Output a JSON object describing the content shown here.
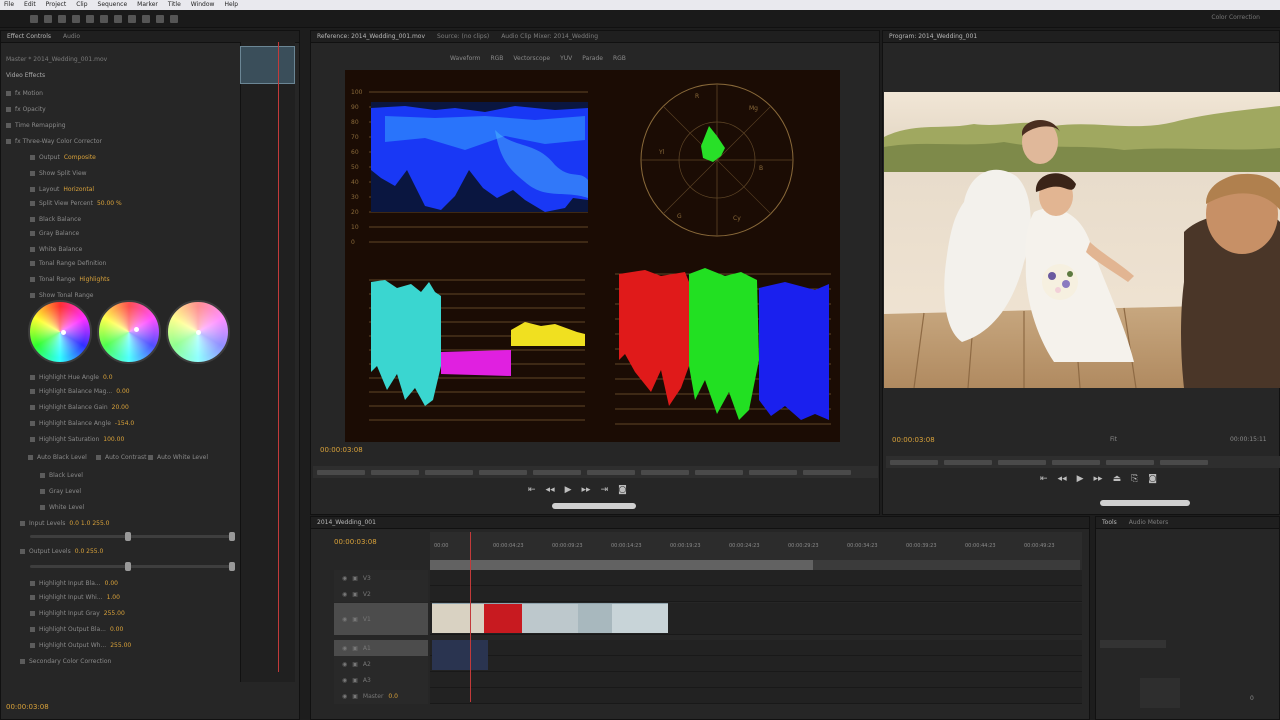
{
  "menu": [
    "File",
    "Edit",
    "Project",
    "Clip",
    "Sequence",
    "Marker",
    "Title",
    "Window",
    "Help"
  ],
  "workspace": "Color Correction",
  "effect_controls": {
    "tabs": [
      "Effect Controls",
      "Audio"
    ],
    "master_label": "Master * 2014_Wedding_001.mov",
    "sequence_label": "2014_Wedding_001.mov",
    "section": "Video Effects",
    "rows": [
      {
        "label": "fx  Motion",
        "value": ""
      },
      {
        "label": "fx  Opacity",
        "value": ""
      },
      {
        "label": "Time Remapping",
        "value": ""
      },
      {
        "label": "fx  Three-Way Color Corrector",
        "value": ""
      },
      {
        "label": "Output",
        "value": "Composite"
      },
      {
        "label": "Show Split View",
        "value": ""
      },
      {
        "label": "Layout",
        "value": "Horizontal"
      },
      {
        "label": "Split View Percent",
        "value": "50.00 %"
      },
      {
        "label": "Black Balance",
        "value": ""
      },
      {
        "label": "Gray Balance",
        "value": ""
      },
      {
        "label": "White Balance",
        "value": ""
      },
      {
        "label": "Tonal Range Definition",
        "value": ""
      },
      {
        "label": "Tonal Range",
        "value": "Highlights"
      },
      {
        "label": "Show Tonal Range",
        "value": ""
      },
      {
        "label": "Highlight Hue Angle",
        "value": "0.0"
      },
      {
        "label": "Highlight Balance Mag...",
        "value": "0.00"
      },
      {
        "label": "Highlight Balance Gain",
        "value": "20.00"
      },
      {
        "label": "Highlight Balance Angle",
        "value": "-154.0"
      },
      {
        "label": "Highlight Saturation",
        "value": "100.00"
      },
      {
        "label": "Auto Black Level",
        "value": ""
      },
      {
        "label": "Auto Contrast",
        "value": ""
      },
      {
        "label": "Auto White Level",
        "value": ""
      },
      {
        "label": "Black Level",
        "value": ""
      },
      {
        "label": "Gray Level",
        "value": ""
      },
      {
        "label": "White Level",
        "value": ""
      },
      {
        "label": "Input Levels",
        "value": "0.0   1.0   255.0"
      },
      {
        "label": "Output Levels",
        "value": "0.0   255.0"
      },
      {
        "label": "Highlight Input Bla...",
        "value": "0.00"
      },
      {
        "label": "Highlight Input Whi...",
        "value": "1.00"
      },
      {
        "label": "Highlight Input Gray",
        "value": "255.00"
      },
      {
        "label": "Highlight Output Bla...",
        "value": "0.00"
      },
      {
        "label": "Highlight Output Wh...",
        "value": "255.00"
      },
      {
        "label": "Secondary Color Correction",
        "value": ""
      }
    ],
    "current_time": "00:00:03:08",
    "wheels": [
      {
        "name": "shadows",
        "dot_x": 0.55,
        "dot_y": 0.5
      },
      {
        "name": "midtones",
        "dot_x": 0.62,
        "dot_y": 0.45
      },
      {
        "name": "highlights",
        "dot_x": 0.5,
        "dot_y": 0.5
      }
    ]
  },
  "source": {
    "tab": "Reference: 2014_Wedding_001.mov",
    "tab2": "Source: (no clips)",
    "tab3": "Audio Clip Mixer: 2014_Wedding",
    "controls": [
      "Waveform",
      "RGB",
      "Vectorscope",
      "YUV",
      "Parade",
      "RGB"
    ],
    "timecode": "00:00:03:08",
    "scale_labels": [
      "100",
      "90",
      "80",
      "70",
      "60",
      "50",
      "40",
      "30",
      "20",
      "10",
      "0"
    ]
  },
  "program": {
    "tab": "Program: 2014_Wedding_001",
    "timecode": "00:00:03:08",
    "fit": "Fit",
    "duration": "00:00:15:11",
    "quality": "Full"
  },
  "timeline": {
    "tab": "2014_Wedding_001",
    "timecode": "00:00:03:08",
    "ruler_marks": [
      "00:00",
      "00:00:04:23",
      "00:00:09:23",
      "00:00:14:23",
      "00:00:19:23",
      "00:00:24:23",
      "00:00:29:23",
      "00:00:34:23",
      "00:00:39:23",
      "00:00:44:23",
      "00:00:49:23"
    ],
    "tracks": [
      "V3",
      "V2",
      "V1",
      "A1",
      "A2",
      "A3",
      "Master"
    ],
    "master_value": "0.0"
  },
  "right_panel": {
    "tabs": [
      "Tools",
      "Audio Meters"
    ],
    "db": "0"
  },
  "colors": {
    "accent": "#d9a23a",
    "playhead": "#c23a3a",
    "scope_bg": "#1b0c04"
  }
}
